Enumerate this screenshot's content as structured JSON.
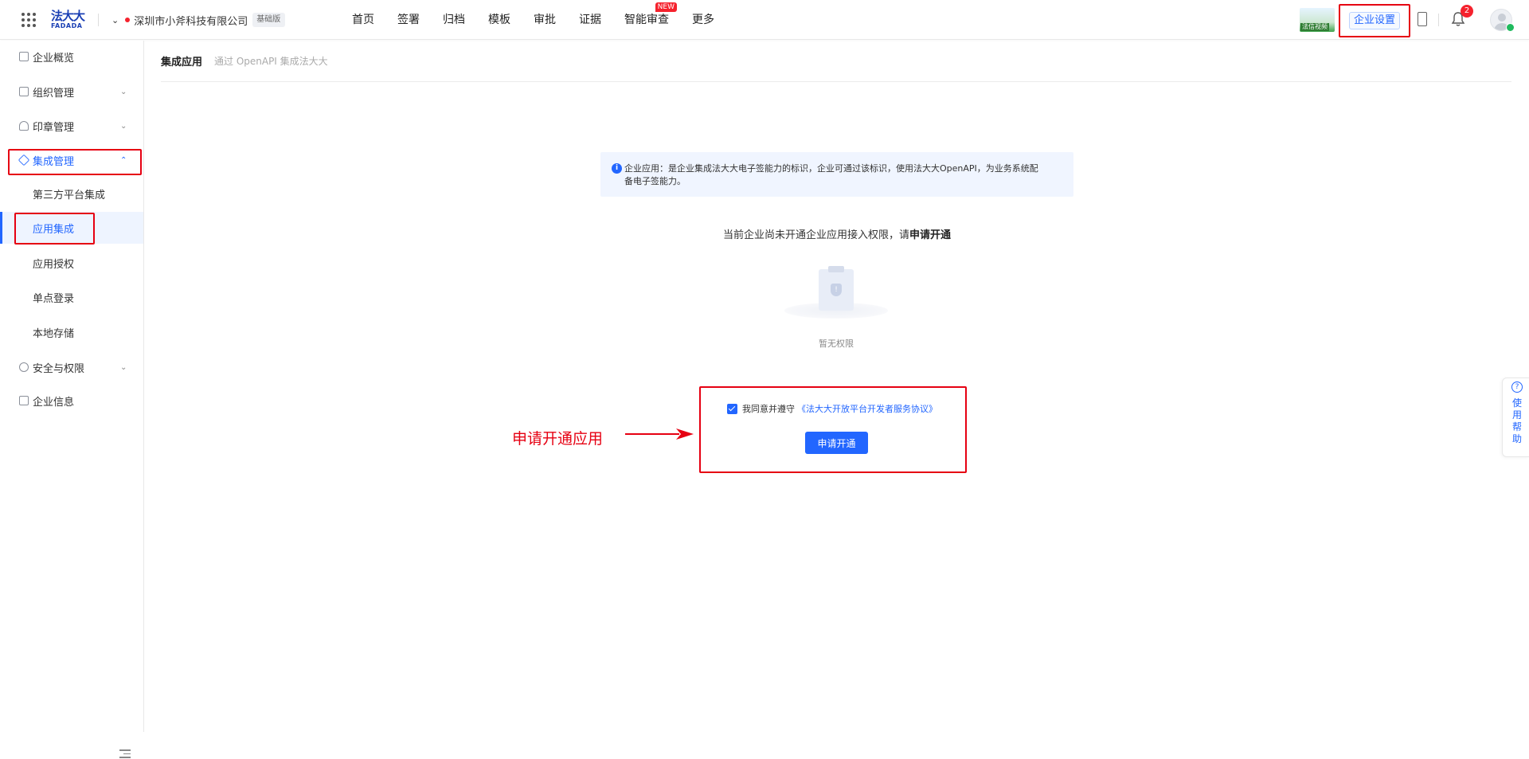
{
  "header": {
    "logo_cn": "法大大",
    "logo_en": "FADADA",
    "company_name": "深圳市小斧科技有限公司",
    "edition_badge": "基础版",
    "nav": [
      {
        "label": "首页"
      },
      {
        "label": "签署"
      },
      {
        "label": "归档"
      },
      {
        "label": "模板"
      },
      {
        "label": "审批"
      },
      {
        "label": "证据"
      },
      {
        "label": "智能审查",
        "tag": "NEW"
      },
      {
        "label": "更多"
      }
    ],
    "thumbnail_caption": "法信视频",
    "enterprise_settings": "企业设置",
    "notification_count": "2"
  },
  "sidebar": {
    "items": [
      {
        "label": "企业概览"
      },
      {
        "label": "组织管理"
      },
      {
        "label": "印章管理"
      },
      {
        "label": "集成管理"
      },
      {
        "label": "安全与权限"
      },
      {
        "label": "企业信息"
      }
    ],
    "subitems": [
      {
        "label": "第三方平台集成"
      },
      {
        "label": "应用集成"
      },
      {
        "label": "应用授权"
      },
      {
        "label": "单点登录"
      },
      {
        "label": "本地存储"
      }
    ]
  },
  "main": {
    "title": "集成应用",
    "subtitle": "通过 OpenAPI 集成法大大",
    "info_line1": "企业应用：是企业集成法大大电子签能力的标识，企业可通过该标识，使用法大大OpenAPI，为业务系统配",
    "info_line2": "备电子签能力。",
    "notice_prefix": "当前企业尚未开通企业应用接入权限，请",
    "notice_bold": "申请开通",
    "empty_text": "暂无权限",
    "agree_text": "我同意并遵守",
    "agree_link": "《法大大开放平台开发者服务协议》",
    "apply_button": "申请开通"
  },
  "annotation": {
    "label": "申请开通应用"
  },
  "help": {
    "label": "使用帮助"
  },
  "colors": {
    "accent": "#2266ff",
    "highlight": "#e60012",
    "badge": "#f5222d"
  }
}
